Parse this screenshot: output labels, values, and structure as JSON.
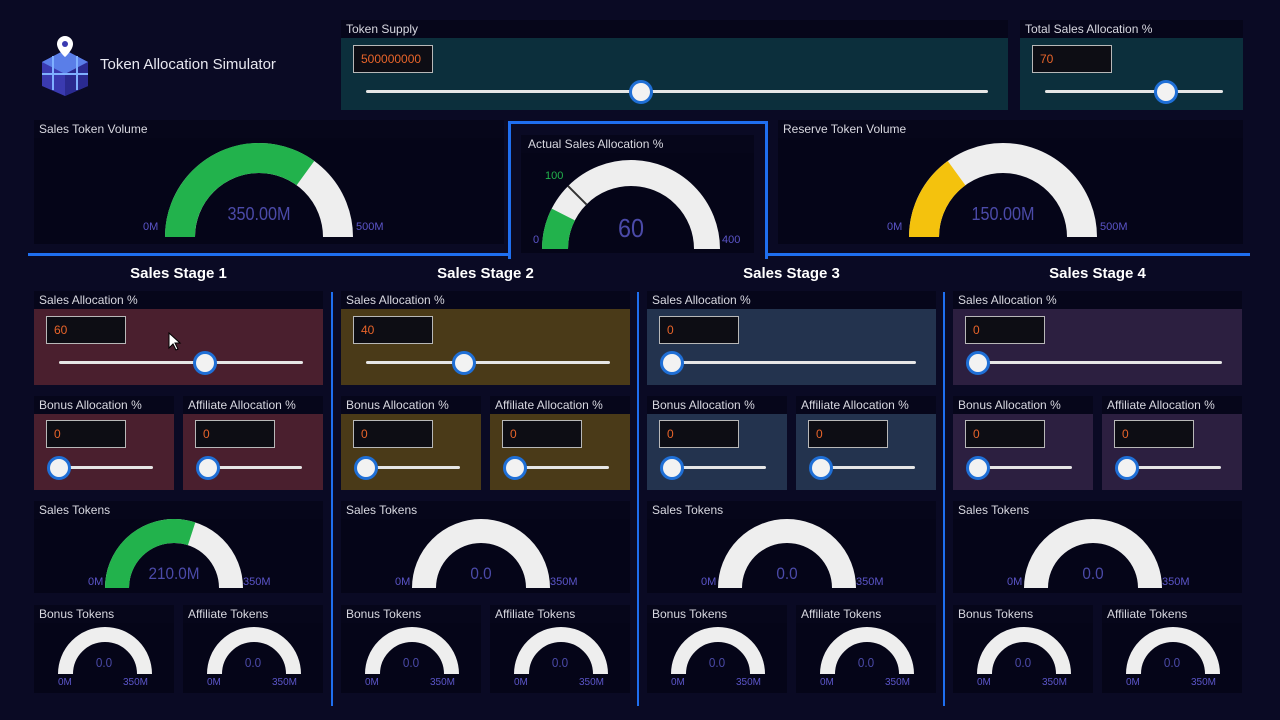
{
  "app": {
    "title": "Token Allocation Simulator"
  },
  "token_supply": {
    "label": "Token Supply",
    "value": "500000000",
    "slider_fraction": 0.5
  },
  "total_sales_alloc": {
    "label": "Total Sales Allocation %",
    "value": "70",
    "slider_fraction": 0.7
  },
  "sales_token_volume": {
    "label": "Sales Token Volume",
    "value": "350.00M",
    "min": "0M",
    "max": "500M",
    "fraction": 0.7,
    "fill": "#22b24c"
  },
  "actual_sales_alloc": {
    "label": "Actual Sales Allocation %",
    "value": "60",
    "min": "0",
    "max": "400",
    "target": "100",
    "fraction": 0.15,
    "target_fraction": 0.25,
    "fill": "#22b24c"
  },
  "reserve_token_volume": {
    "label": "Reserve Token Volume",
    "value": "150.00M",
    "min": "0M",
    "max": "500M",
    "fraction": 0.3,
    "fill": "#f4c20d"
  },
  "labels": {
    "sales_alloc": "Sales Allocation %",
    "bonus_alloc": "Bonus Allocation %",
    "affiliate_alloc": "Affiliate Allocation %",
    "sales_tokens": "Sales Tokens",
    "bonus_tokens": "Bonus Tokens",
    "affiliate_tokens": "Affiliate Tokens",
    "min_m": "0M",
    "max_350": "350M"
  },
  "stages": [
    {
      "title": "Sales Stage 1",
      "color": "#4a1f2e",
      "sales_alloc": "60",
      "sales_alloc_fraction": 0.6,
      "bonus_alloc": "0",
      "bonus_alloc_fraction": 0,
      "affiliate_alloc": "0",
      "affiliate_alloc_fraction": 0,
      "sales_tokens": "210.0M",
      "sales_tokens_fraction": 0.6,
      "bonus_tokens": "0.0",
      "affiliate_tokens": "0.0"
    },
    {
      "title": "Sales Stage 2",
      "color": "#4a3a18",
      "sales_alloc": "40",
      "sales_alloc_fraction": 0.4,
      "bonus_alloc": "0",
      "bonus_alloc_fraction": 0,
      "affiliate_alloc": "0",
      "affiliate_alloc_fraction": 0,
      "sales_tokens": "0.0",
      "sales_tokens_fraction": 0,
      "bonus_tokens": "0.0",
      "affiliate_tokens": "0.0"
    },
    {
      "title": "Sales Stage 3",
      "color": "#23334e",
      "sales_alloc": "0",
      "sales_alloc_fraction": 0,
      "bonus_alloc": "0",
      "bonus_alloc_fraction": 0,
      "affiliate_alloc": "0",
      "affiliate_alloc_fraction": 0,
      "sales_tokens": "0.0",
      "sales_tokens_fraction": 0,
      "bonus_tokens": "0.0",
      "affiliate_tokens": "0.0"
    },
    {
      "title": "Sales Stage 4",
      "color": "#2c1f40",
      "sales_alloc": "0",
      "sales_alloc_fraction": 0,
      "bonus_alloc": "0",
      "bonus_alloc_fraction": 0,
      "affiliate_alloc": "0",
      "affiliate_alloc_fraction": 0,
      "sales_tokens": "0.0",
      "sales_tokens_fraction": 0,
      "bonus_tokens": "0.0",
      "affiliate_tokens": "0.0"
    }
  ],
  "colors": {
    "accent": "#1f6ff0",
    "gauge_track": "#eeeeee",
    "gauge_fill": "#22b24c",
    "reserve_fill": "#f4c20d",
    "input_text": "#e8642a"
  }
}
